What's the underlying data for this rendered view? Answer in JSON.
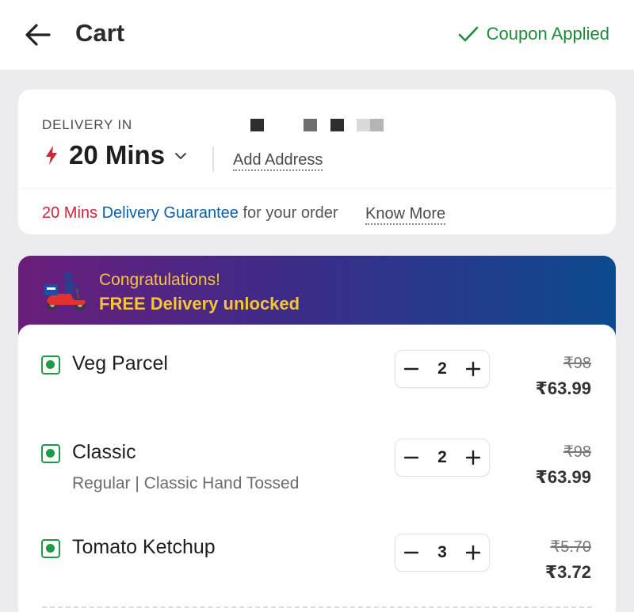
{
  "header": {
    "title": "Cart",
    "coupon_status": "Coupon Applied",
    "back_icon": "arrow-left-icon",
    "coupon_icon": "check-icon",
    "coupon_color": "#1e8a3c"
  },
  "delivery": {
    "label": "DELIVERY IN",
    "time": "20 Mins",
    "add_address": "Add Address",
    "guarantee": {
      "time": "20 Mins",
      "text": "Delivery Guarantee",
      "suffix": "for your order",
      "link": "Know More"
    }
  },
  "banner": {
    "line1": "Congratulations!",
    "line2": "FREE Delivery unlocked",
    "text_color": "#f6c533"
  },
  "items": [
    {
      "name": "Veg Parcel",
      "description": "",
      "quantity": "2",
      "original_price": "₹98",
      "price": "₹63.99"
    },
    {
      "name": "Classic",
      "description": "Regular | Classic Hand Tossed",
      "quantity": "2",
      "original_price": "₹98",
      "price": "₹63.99"
    },
    {
      "name": "Tomato Ketchup",
      "description": "",
      "quantity": "3",
      "original_price": "₹5.70",
      "price": "₹3.72"
    }
  ],
  "colors": {
    "veg_indicator": "#1e9a48",
    "accent_red": "#d1233a",
    "accent_blue": "#0f5ea8"
  }
}
